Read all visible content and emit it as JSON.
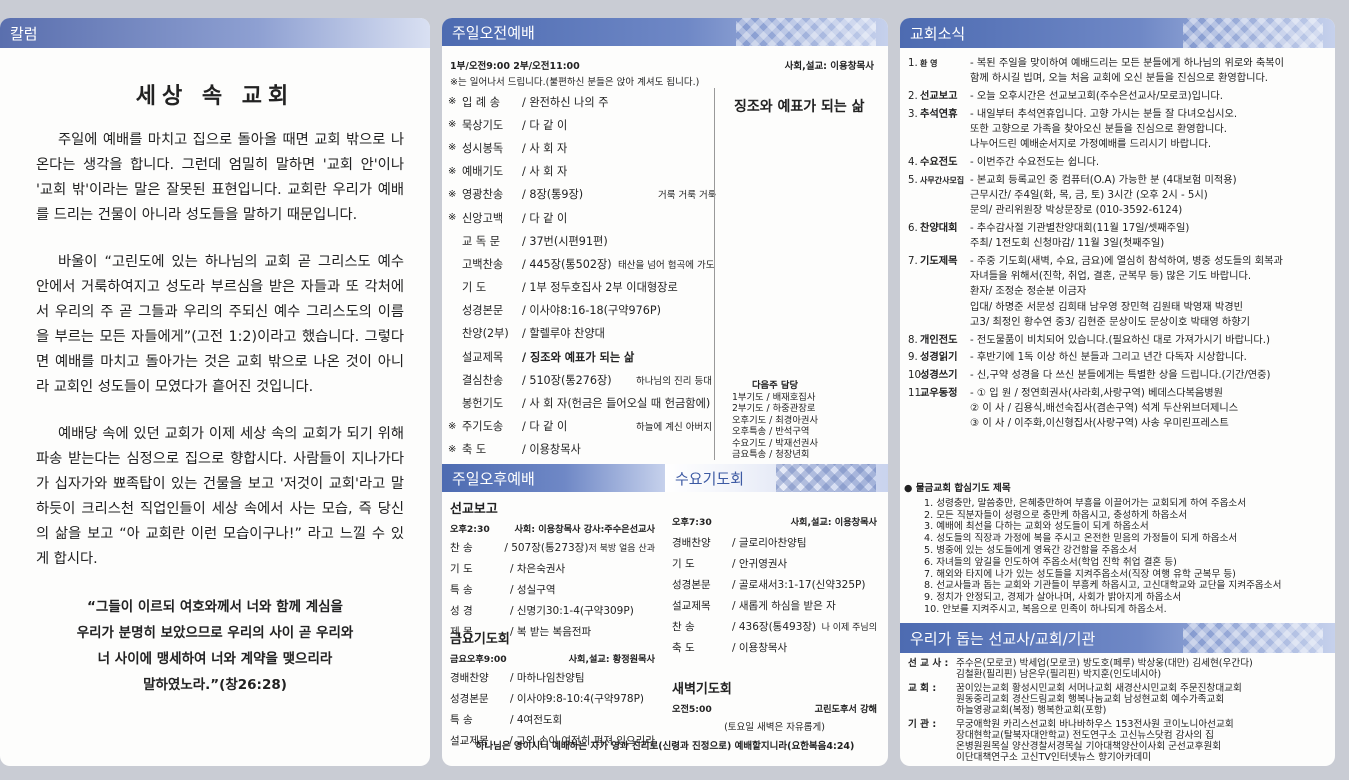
{
  "col1": {
    "header": "칼럼",
    "title": "세상 속 교회",
    "paragraphs": [
      "주일에 예배를 마치고 집으로 돌아올 때면 교회 밖으로 나온다는 생각을 합니다. 그런데 엄밀히 말하면 '교회 안'이나 '교회 밖'이라는 말은 잘못된 표현입니다. 교회란 우리가 예배를 드리는 건물이 아니라 성도들을 말하기 때문입니다.",
      "바울이 “고린도에 있는 하나님의 교회 곧 그리스도 예수 안에서 거룩하여지고 성도라 부르심을 받은 자들과 또 각처에서 우리의 주 곧 그들과 우리의 주되신 예수 그리스도의 이름을 부르는 모든 자들에게”(고전 1:2)이라고 했습니다. 그렇다면 예배를 마치고 돌아가는 것은 교회 밖으로 나온 것이 아니라 교회인 성도들이 모였다가 흩어진 것입니다.",
      "예배당 속에 있던 교회가 이제 세상 속의 교회가 되기 위해 파송 받는다는 심정으로 집으로 향합시다. 사람들이 지나가다가 십자가와 뾰족탑이 있는 건물을 보고 '저것이 교회'라고 말하듯이 크리스천 직업인들이 세상 속에서 사는 모습, 즉 당신의 삶을 보고 “아 교회란 이런 모습이구나!” 라고 느낄 수 있게 합시다."
    ],
    "quote": [
      "“그들이 이르되 여호와께서 너와 함께 계심을",
      "우리가 분명히 보았으므로 우리의 사이 곧 우리와",
      "너 사이에 맹세하여 너와 계약을 맺으리라",
      "말하였노라.”(창26:28)"
    ]
  },
  "col2": {
    "morning": {
      "header": "주일오전예배",
      "times": "1부/오전9:00  2부/오전11:00",
      "officiant": "사회,설교: 이용창목사",
      "note": "※는 일어나서 드립니다.(불편하신 분들은 앉아 계셔도 됩니다.)",
      "sermon_title": "징조와 예표가 되는 삶",
      "items": [
        {
          "mk": "※",
          "name": "입 례 송",
          "val": "/ 완전하신 나의 주",
          "extra": ""
        },
        {
          "mk": "※",
          "name": "묵상기도",
          "val": "/ 다 같 이",
          "extra": ""
        },
        {
          "mk": "※",
          "name": "성시봉독",
          "val": "/ 사 회 자",
          "extra": ""
        },
        {
          "mk": "※",
          "name": "예배기도",
          "val": "/ 사 회 자",
          "extra": ""
        },
        {
          "mk": "※",
          "name": "영광찬송",
          "val": "/ 8장(통9장)",
          "extra": "거룩 거룩 거룩"
        },
        {
          "mk": "※",
          "name": "신앙고백",
          "val": "/ 다 같 이",
          "extra": ""
        },
        {
          "mk": "",
          "name": "교 독 문",
          "val": "/ 37번(시편91편)",
          "extra": ""
        },
        {
          "mk": "",
          "name": "고백찬송",
          "val": "/ 445장(통502장)",
          "extra": "태산을 넘어 험곡에 가도"
        },
        {
          "mk": "",
          "name": "기    도",
          "val": "/ 1부 정두호집사  2부 이대형장로",
          "extra": ""
        },
        {
          "mk": "",
          "name": "성경본문",
          "val": "/ 이사야8:16-18(구약976P)",
          "extra": ""
        },
        {
          "mk": "",
          "name": "찬양(2부)",
          "val": "/ 할렐루야 찬양대",
          "extra": ""
        },
        {
          "mk": "",
          "name": "설교제목",
          "val": "/ 징조와 예표가 되는 삶",
          "extra": ""
        },
        {
          "mk": "",
          "name": "결심찬송",
          "val": "/ 510장(통276장)",
          "extra": "하나님의 진리 등대"
        },
        {
          "mk": "",
          "name": "봉헌기도",
          "val": "/ 사 회 자(헌금은 들어오실 때 헌금함에)",
          "extra": ""
        },
        {
          "mk": "※",
          "name": "주기도송",
          "val": "/ 다 같 이",
          "extra": "하늘에 계신 아버지"
        },
        {
          "mk": "※",
          "name": "축    도",
          "val": "/ 이용창목사",
          "extra": ""
        }
      ],
      "duty": {
        "title": "다음주 담당",
        "rows": [
          "1부기도 / 배재호집사",
          "2부기도 / 하중관장로",
          "오후기도 / 최경아권사",
          "오후특송 / 반석구역",
          "수요기도 / 박재선권사",
          "금요특송 / 청장년회"
        ]
      }
    },
    "afternoon": {
      "header": "주일오후예배",
      "section": "선교보고",
      "time": "오후2:30",
      "officiant": "사회: 이용창목사 강사:주수은선교사",
      "items": [
        {
          "name": "찬    송",
          "val": "/ 507장(통273장)",
          "extra": "저 북방 얼음 산과"
        },
        {
          "name": "기    도",
          "val": "/ 차은숙권사",
          "extra": ""
        },
        {
          "name": "특    송",
          "val": "/ 성실구역",
          "extra": ""
        },
        {
          "name": "성    경",
          "val": "/ 신명기30:1-4(구약309P)",
          "extra": ""
        },
        {
          "name": "제    목",
          "val": "/ 복 받는 복음전파",
          "extra": ""
        }
      ]
    },
    "friday": {
      "title": "금요기도회",
      "time": "금요오후9:00",
      "officiant": "사회,설교: 황정원목사",
      "items": [
        {
          "name": "경배찬양",
          "val": "/ 마하나임찬양팀"
        },
        {
          "name": "성경본문",
          "val": "/ 이사야9:8-10:4(구약978P)"
        },
        {
          "name": "특    송",
          "val": "/ 4여전도회"
        },
        {
          "name": "설교제목",
          "val": "/ 그의 손이 여전히 펴져 있으리라"
        }
      ]
    },
    "wednesday": {
      "header": "수요기도회",
      "time": "오후7:30",
      "officiant": "사회,설교: 이용창목사",
      "items": [
        {
          "name": "경배찬양",
          "val": "/ 글로리아찬양팀",
          "extra": ""
        },
        {
          "name": "기    도",
          "val": "/ 안귀영권사",
          "extra": ""
        },
        {
          "name": "성경본문",
          "val": "/ 골로새서3:1-17(신약325P)",
          "extra": ""
        },
        {
          "name": "설교제목",
          "val": "/ 새롭게 하심을 받은 자",
          "extra": ""
        },
        {
          "name": "찬    송",
          "val": "/ 436장(통493장)",
          "extra": "나 이제 주님의"
        },
        {
          "name": "축    도",
          "val": "/ 이용창목사",
          "extra": ""
        }
      ]
    },
    "dawn": {
      "title": "새벽기도회",
      "time": "오전5:00",
      "officiant": "고린도후서 강해",
      "note": "(토요일 새벽은 자유롭게)"
    },
    "footer": "하나님은 영이시니 예배하는 자가 영과 진리로(신령과 진정으로) 예배할지니라(요한복음4:24)"
  },
  "col3": {
    "header": "교회소식",
    "news": [
      {
        "num": "1.",
        "label": "환    영",
        "text": "- 복된 주일을 맞이하여 예배드리는 모든 분들에게 하나님의 위로와 축복이\n  함께 하시길 빕며, 오늘 처음 교회에 오신 분들을 진심으로 환영합니다."
      },
      {
        "num": "2.",
        "label": "선교보고",
        "text": "- 오늘 오후시간은 선교보고회(주수은선교사/모로코)입니다."
      },
      {
        "num": "3.",
        "label": "추석연휴",
        "text": "- 내일부터 추석연휴입니다. 고향 가시는 분들 잘 다녀오십시오.\n  또한 고향으로 가족을 찾아오신 분들을 진심으로 환영합니다.\n  나누어드린 예배순서지로 가정예배를 드리시기 바랍니다."
      },
      {
        "num": "4.",
        "label": "수요전도",
        "text": "- 이번주간 수요전도는 쉽니다."
      },
      {
        "num": "5.",
        "label": "사무간사모집",
        "text": "- 본교회 등록교인 중 컴퓨터(O.A) 가능한 분 (4대보험 미적용)\n  근무시간/ 주4일(화, 목, 금, 토) 3시간 (오후 2시 - 5시)\n  문의/ 관리위원장 박상문장로 (010-3592-6124)"
      },
      {
        "num": "6.",
        "label": "찬양대회",
        "text": "- 추수감사절 기관별찬양대회(11월 17일/셋째주일)\n  주최/ 1전도회   신청마감/ 11월 3일(첫째주일)"
      },
      {
        "num": "7.",
        "label": "기도제목",
        "text": "- 주중 기도회(새벽, 수요, 금요)에 열심히 참석하여, 병중 성도들의 회복과\n  자녀들을 위해서(진학, 취업, 결혼, 군복무 등) 많은 기도 바랍니다.\n  환자/ 조정순 정순분 이금자\n  입대/ 하명준 서문성 김희태 남우영 장민혁 김원태 박영재 박경빈\n  고3/ 최정인 황수연          중3/ 김현준 문상이도 문상이호 박태영 하향기"
      },
      {
        "num": "8.",
        "label": "개인전도",
        "text": "- 전도물품이 비치되어 있습니다.(필요하신 대로 가져가시기 바랍니다.)"
      },
      {
        "num": "9.",
        "label": "성경읽기",
        "text": "- 후반기에 1독 이상 하신 분들과 그리고 년간 다독자 시상합니다."
      },
      {
        "num": "10.",
        "label": "성경쓰기",
        "text": "- 신,구약 성경을 다 쓰신 분들에게는 특별한 상을 드립니다.(기간/연중)"
      },
      {
        "num": "11.",
        "label": "교우동정",
        "text": "- ① 입 원 / 정연희권사(사라회,사랑구역) 베데스다복음병원\n   ② 이 사 / 김용식,배선숙집사(겸손구역) 석계 두산위브더제니스\n   ③ 이 사 / 이주화,이신형집사(사랑구역) 사송 우미린프레스트"
      }
    ],
    "prayer": {
      "title": "● 물금교회 합심기도 제목",
      "items": [
        "1. 성령충만, 말씀충만, 은혜충만하여 부흥을 이끌어가는 교회되게 하여 주옵소서",
        "2. 모든 직분자들이 성령으로 충만케 하옵시고, 충성하게 하옵소서",
        "3. 예배에 최선을 다하는 교회와 성도들이 되게 하옵소서",
        "4. 성도들의 직장과 가정에 복을 주시고 온전한 믿음의 가정들이 되게 하옵소서",
        "5. 병중에 있는 성도들에게 영육간 강건함을 주옵소서",
        "6. 자녀들의 앞길을 인도하여 주옵소서(학업 진학 취업 결혼 등)",
        "7. 해외와 타지에 나가 있는 성도들을 지켜주옵소서(직장 여행 유학 군복무 등)",
        "8. 선교사들과 돕는 교회와 기관들이 부흥케 하옵시고, 고신대학교와 교단을 지켜주옵소서",
        "9. 정치가 안정되고, 경제가 살아나며, 사회가 밝아지게 하옵소서",
        "10. 안보를 지켜주시고, 복음으로 민족이 하나되게 하옵소서."
      ]
    },
    "missions": {
      "header": "우리가 돕는 선교사/교회/기관",
      "rows": [
        {
          "label": "선 교 사 :",
          "text": "주수은(모로코) 박세업(모로코) 방도호(페루) 박상웅(대만) 김세현(우간다)\n김철환(필리핀) 남은우(필리핀) 박지훈(인도네시아)"
        },
        {
          "label": "교    회 :",
          "text": "꿈이있는교회 황성시민교회 서머나교회 새경산시민교회 주문진창대교회\n원동중리교회 경산드림교회 행복나눔교회 남성현교회 예수가족교회\n하늘영광교회(복정) 행복한교회(포항)"
        },
        {
          "label": "기    관 :",
          "text": "무궁애학원 카리스선교회 바나바하우스 153전사원 코이노니아선교회\n장대현학교(탈북자대안학교) 전도연구소 고신뉴스닷컴 감사의 집\n온병원원목실 양산경찰서경목실 기아대책양산이사회 군선교후원회\n이단대책연구소 고신TV인터넷뉴스 향기아카데미"
        }
      ]
    }
  }
}
